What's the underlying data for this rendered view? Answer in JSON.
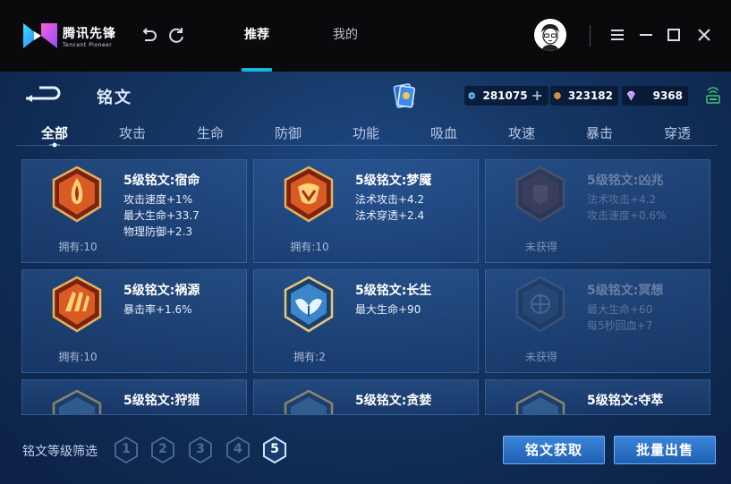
{
  "app": {
    "logo_zh": "腾讯先锋",
    "logo_en": "Tencent Pioneer"
  },
  "topbar": {
    "tabs": [
      {
        "label": "推荐",
        "active": true
      },
      {
        "label": "我的",
        "active": false
      }
    ],
    "icons": [
      "undo-icon",
      "refresh-icon",
      "menu-icon",
      "minimize-icon",
      "maximize-icon",
      "close-icon"
    ]
  },
  "panel": {
    "title": "铭文",
    "currencies": [
      {
        "icon": "blue-gem-coin-icon",
        "value": "281075",
        "color": "#4fb2ff",
        "has_plus": true
      },
      {
        "icon": "gold-coin-icon",
        "value": "323182",
        "color": "#f2a52b"
      },
      {
        "icon": "purple-crystal-icon",
        "value": "9368",
        "color": "#c58bff"
      }
    ]
  },
  "categories": [
    "全部",
    "攻击",
    "生命",
    "防御",
    "功能",
    "吸血",
    "攻速",
    "暴击",
    "穿透"
  ],
  "cards": [
    {
      "name": "5级铭文:宿命",
      "stats": [
        "攻击速度+1%",
        "最大生命+33.7",
        "物理防御+2.3"
      ],
      "owned": "拥有:10",
      "color": "red",
      "locked": false
    },
    {
      "name": "5级铭文:梦魇",
      "stats": [
        "法术攻击+4.2",
        "法术穿透+2.4"
      ],
      "owned": "拥有:10",
      "color": "red",
      "locked": false
    },
    {
      "name": "5级铭文:凶兆",
      "stats": [
        "法术攻击+4.2",
        "攻击速度+0.6%"
      ],
      "owned": "未获得",
      "color": "red",
      "locked": true
    },
    {
      "name": "5级铭文:祸源",
      "stats": [
        "暴击率+1.6%"
      ],
      "owned": "拥有:10",
      "color": "red",
      "locked": false
    },
    {
      "name": "5级铭文:长生",
      "stats": [
        "最大生命+90"
      ],
      "owned": "拥有:2",
      "color": "blue",
      "locked": false
    },
    {
      "name": "5级铭文:冥想",
      "stats": [
        "最大生命+60",
        "每5秒回血+7"
      ],
      "owned": "未获得",
      "color": "blue",
      "locked": true
    },
    {
      "name": "5级铭文:狩猎",
      "stats": [],
      "owned": "",
      "color": "blue",
      "locked": false
    },
    {
      "name": "5级铭文:贪婪",
      "stats": [],
      "owned": "",
      "color": "blue",
      "locked": false
    },
    {
      "name": "5级铭文:夺萃",
      "stats": [],
      "owned": "",
      "color": "blue",
      "locked": false
    }
  ],
  "bottom": {
    "filter_label": "铭文等级筛选",
    "levels": [
      "1",
      "2",
      "3",
      "4",
      "5"
    ],
    "active_level": "5",
    "buttons": {
      "acquire": "铭文获取",
      "bulk_sell": "批量出售"
    }
  }
}
